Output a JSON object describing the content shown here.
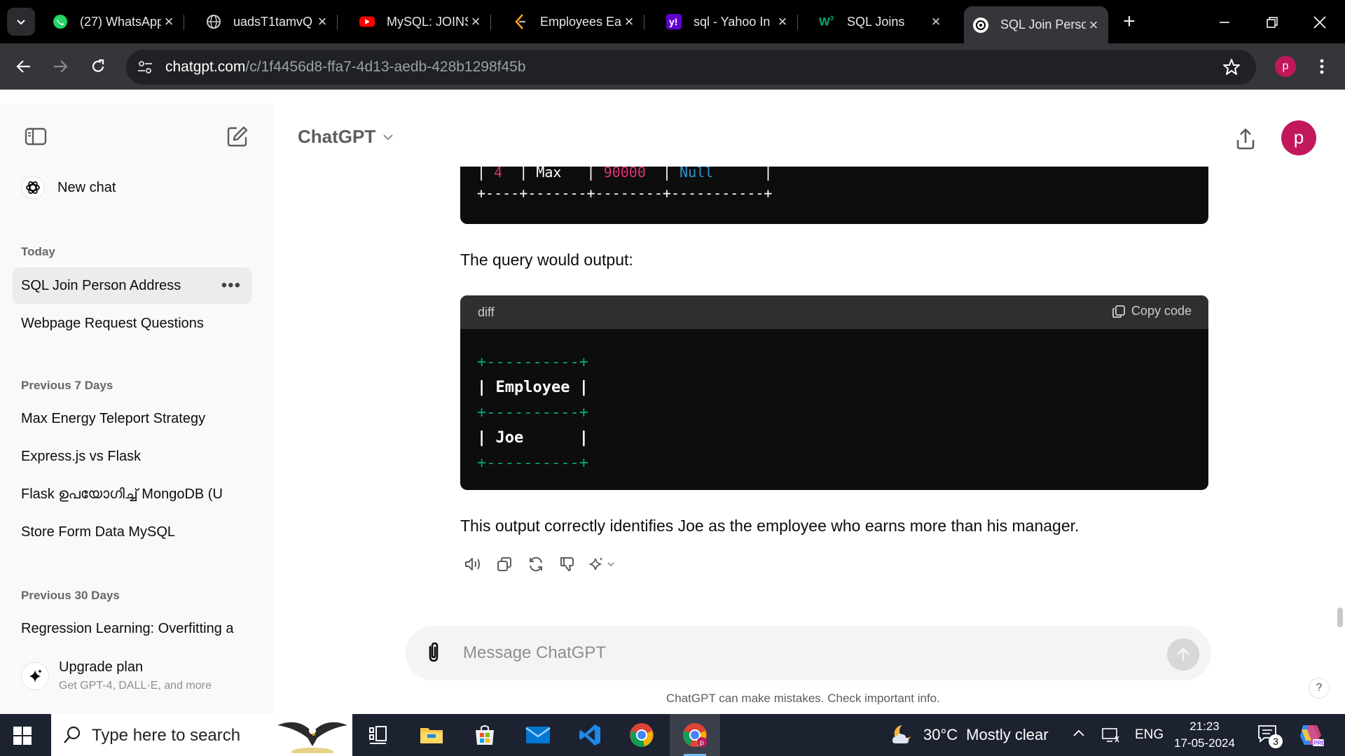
{
  "browser": {
    "tabs": [
      {
        "title": "(27) WhatsApp",
        "icon": "whatsapp-icon"
      },
      {
        "title": "uadsT1tamvQ",
        "icon": "globe-icon"
      },
      {
        "title": "MySQL: JOINS",
        "icon": "youtube-icon"
      },
      {
        "title": "Employees Ea",
        "icon": "leetcode-icon"
      },
      {
        "title": "sql - Yahoo In",
        "icon": "yahoo-icon"
      },
      {
        "title": "SQL Joins",
        "icon": "w3schools-icon"
      },
      {
        "title": "SQL Join Perso",
        "icon": "chatgpt-icon",
        "active": true
      }
    ],
    "url_host": "chatgpt.com",
    "url_path": "/c/1f4456d8-ffa7-4d13-aedb-428b1298f45b",
    "profile_initial": "p"
  },
  "sidebar": {
    "new_chat": "New chat",
    "sections": [
      {
        "label": "Today",
        "items": [
          "SQL Join Person Address",
          "Webpage Request Questions"
        ]
      },
      {
        "label": "Previous 7 Days",
        "items": [
          "Max Energy Teleport Strategy",
          "Express.js vs Flask",
          "Flask ഉപയോഗിച്ച് MongoDB (U",
          "Store Form Data MySQL"
        ]
      },
      {
        "label": "Previous 30 Days",
        "items": [
          "Regression Learning: Overfitting a"
        ]
      }
    ],
    "upgrade_title": "Upgrade plan",
    "upgrade_subtitle": "Get GPT-4, DALL·E, and more"
  },
  "main": {
    "model_name": "ChatGPT",
    "avatar_initial": "p",
    "top_code": {
      "row_id": "4",
      "row_name": "Max",
      "row_salary": "90000",
      "row_manager": "Null",
      "border": "+----+-------+--------+-----------+"
    },
    "intro_text": "The query would output:",
    "code_block": {
      "language": "diff",
      "copy_label": "Copy code",
      "border": "+----------+",
      "header_row": "| Employee |",
      "data_row": "| Joe      |"
    },
    "conclusion_text": "This output correctly identifies Joe as the employee who earns more than his manager.",
    "input_placeholder": "Message ChatGPT",
    "disclaimer": "ChatGPT can make mistakes. Check important info.",
    "help_label": "?"
  },
  "taskbar": {
    "search_placeholder": "Type here to search",
    "temperature": "30°C",
    "weather": "Mostly clear",
    "language": "ENG",
    "time": "21:23",
    "date": "17-05-2024",
    "notification_count": "3"
  },
  "colors": {
    "accent_avatar": "#c2185b",
    "code_bg": "#0d0d0d",
    "code_green": "#00a67d"
  }
}
